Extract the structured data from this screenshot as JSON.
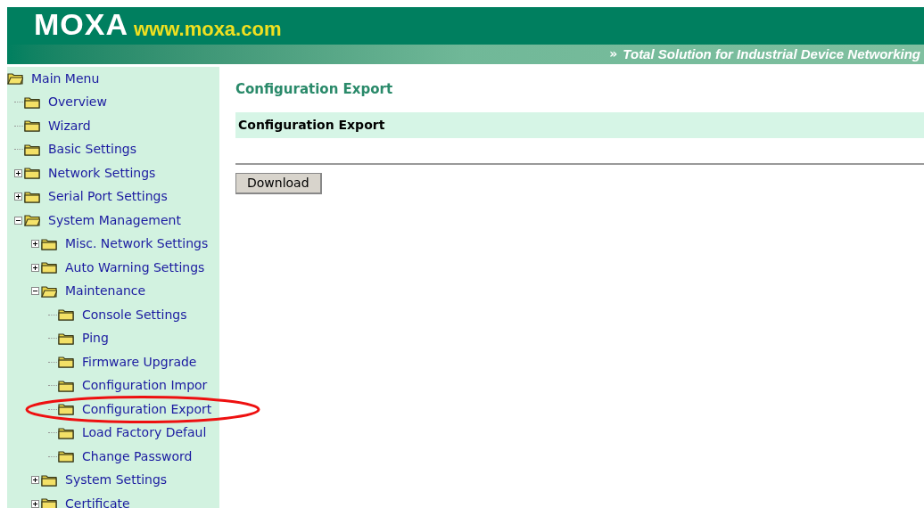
{
  "header": {
    "logo": "MOXA",
    "url": "www.moxa.com",
    "slogan_mark": "»",
    "slogan": "Total Solution for Industrial Device Networking"
  },
  "sidebar": {
    "tree": [
      {
        "label": "Main Menu",
        "children": [
          {
            "label": "Overview"
          },
          {
            "label": "Wizard"
          },
          {
            "label": "Basic Settings"
          },
          {
            "label": "Network Settings",
            "expanded": false
          },
          {
            "label": "Serial Port Settings",
            "expanded": false
          },
          {
            "label": "System Management",
            "expanded": true,
            "children": [
              {
                "label": "Misc. Network Settings",
                "expanded": false
              },
              {
                "label": "Auto Warning Settings",
                "expanded": false
              },
              {
                "label": "Maintenance",
                "expanded": true,
                "children": [
                  {
                    "label": "Console Settings"
                  },
                  {
                    "label": "Ping"
                  },
                  {
                    "label": "Firmware Upgrade"
                  },
                  {
                    "label": "Configuration Impor"
                  },
                  {
                    "label": "Configuration Export",
                    "selected": true
                  },
                  {
                    "label": "Load Factory Defaul"
                  },
                  {
                    "label": "Change Password"
                  }
                ]
              },
              {
                "label": "System Settings",
                "expanded": false
              },
              {
                "label": "Certificate",
                "expanded": false
              }
            ]
          }
        ]
      }
    ]
  },
  "main": {
    "title": "Configuration Export",
    "section_title": "Configuration Export",
    "button": "Download"
  }
}
